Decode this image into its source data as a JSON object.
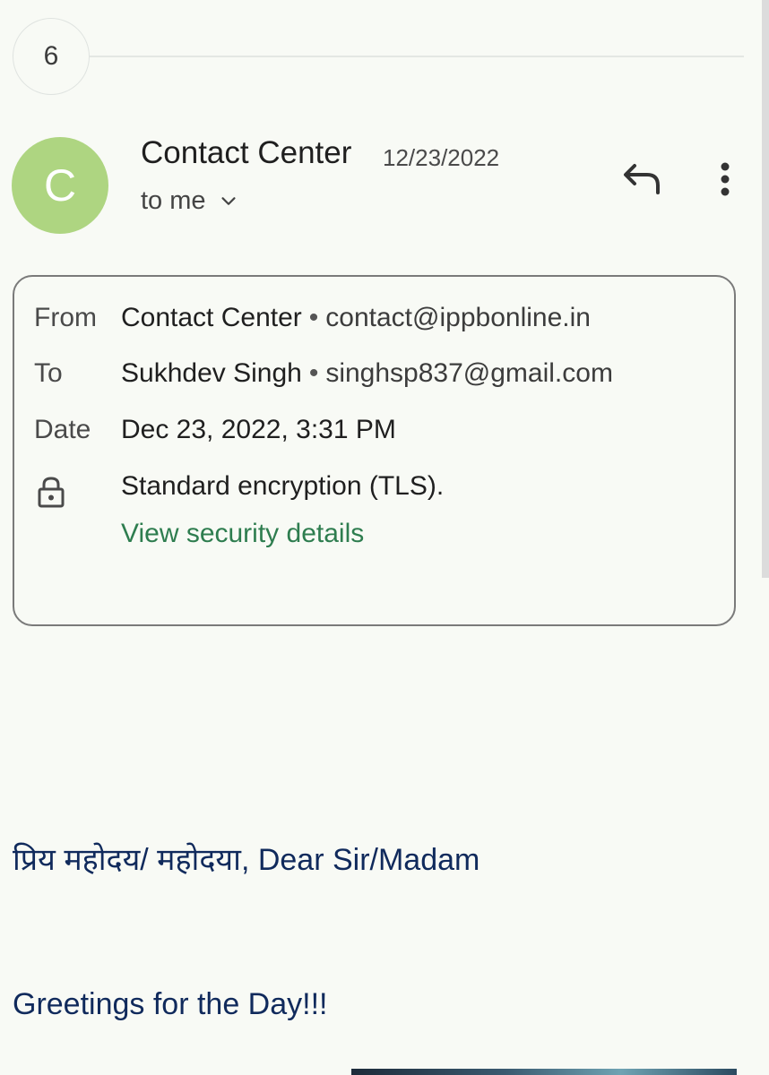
{
  "thread": {
    "count": "6"
  },
  "header": {
    "avatar_letter": "C",
    "sender_name": "Contact Center",
    "date": "12/23/2022",
    "recipient_summary": "to me",
    "icons": {
      "expand": "chevron-down-icon",
      "reply": "reply-icon",
      "more": "more-vert-icon"
    }
  },
  "details": {
    "from_label": "From",
    "from_name": "Contact Center",
    "from_email": "contact@ippbonline.in",
    "to_label": "To",
    "to_name": "Sukhdev Singh",
    "to_email": "singhsp837@gmail.com",
    "date_label": "Date",
    "date_value": "Dec 23, 2022, 3:31 PM",
    "separator": "•",
    "encryption_text": "Standard encryption (TLS).",
    "security_link": "View security details"
  },
  "body": {
    "salutation": "प्रिय महोदय/ महोदया, Dear Sir/Madam",
    "greeting": "Greetings for the Day!!!"
  },
  "colors": {
    "background": "#f8faf5",
    "avatar": "#aed581",
    "link": "#2e7d4f",
    "body_text": "#102a5c"
  }
}
